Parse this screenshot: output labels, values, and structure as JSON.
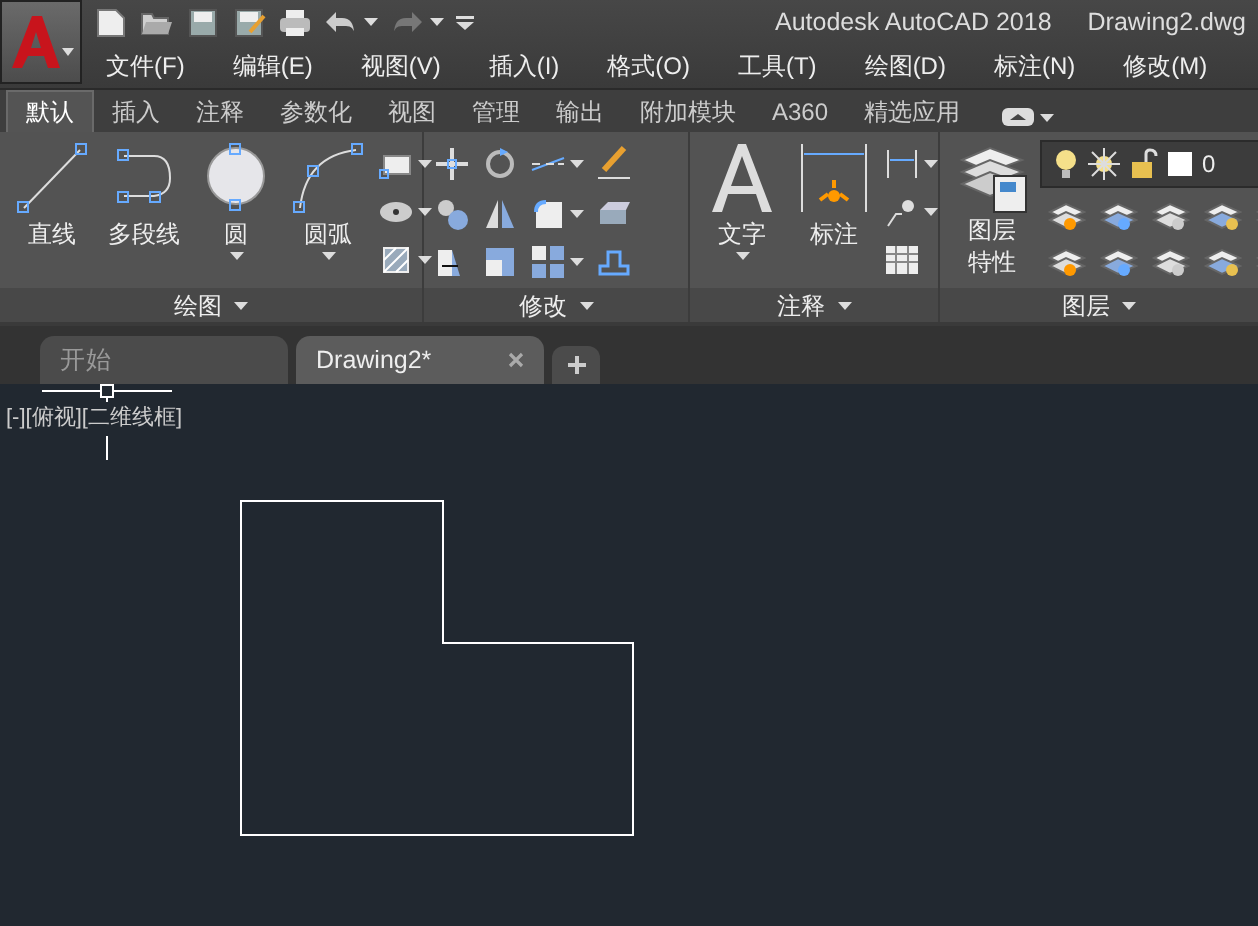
{
  "title_bar": {
    "title": "Autodesk AutoCAD 2018",
    "file": "Drawing2.dwg"
  },
  "menu": [
    "文件(F)",
    "编辑(E)",
    "视图(V)",
    "插入(I)",
    "格式(O)",
    "工具(T)",
    "绘图(D)",
    "标注(N)",
    "修改(M)"
  ],
  "ribbon_tabs": [
    {
      "label": "默认",
      "selected": true
    },
    {
      "label": "插入",
      "selected": false
    },
    {
      "label": "注释",
      "selected": false
    },
    {
      "label": "参数化",
      "selected": false
    },
    {
      "label": "视图",
      "selected": false
    },
    {
      "label": "管理",
      "selected": false
    },
    {
      "label": "输出",
      "selected": false
    },
    {
      "label": "附加模块",
      "selected": false
    },
    {
      "label": "A360",
      "selected": false
    },
    {
      "label": "精选应用",
      "selected": false
    }
  ],
  "panels": [
    {
      "kind": "draw",
      "title": "绘图",
      "tools": [
        {
          "label": "直线",
          "dropdown": false
        },
        {
          "label": "多段线",
          "dropdown": false
        },
        {
          "label": "圆",
          "dropdown": true
        },
        {
          "label": "圆弧",
          "dropdown": true
        }
      ]
    },
    {
      "kind": "modify",
      "title": "修改"
    },
    {
      "kind": "annotate",
      "title": "注释",
      "tools": [
        {
          "label": "文字",
          "dropdown": true
        },
        {
          "label": "标注",
          "dropdown": false
        }
      ]
    },
    {
      "kind": "layers",
      "title": "图层",
      "tools": [
        {
          "label": "图层特性",
          "dropdown": false
        }
      ],
      "current_layer": "0"
    }
  ],
  "doc_tabs": [
    {
      "label": "开始",
      "selected": false,
      "closable": false
    },
    {
      "label": "Drawing2*",
      "selected": true,
      "closable": true
    }
  ],
  "viewport_label": "[-][俯视][二维线框]"
}
